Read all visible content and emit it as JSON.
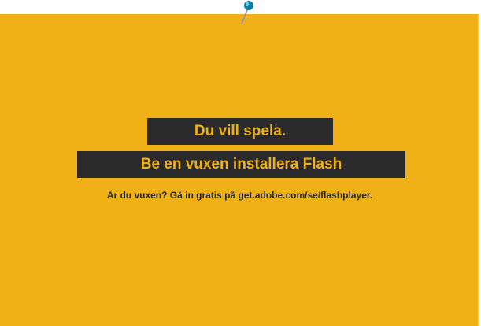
{
  "content": {
    "headline": "Du vill spela.",
    "instruction": "Be en vuxen installera Flash",
    "note": "Är du vuxen? Gå in gratis på get.adobe.com/se/flashplayer."
  },
  "icons": {
    "pin": "push-pin-icon"
  },
  "colors": {
    "background": "#f0b116",
    "banner": "#2a2a2a",
    "pin_head": "#0f7fa6"
  }
}
